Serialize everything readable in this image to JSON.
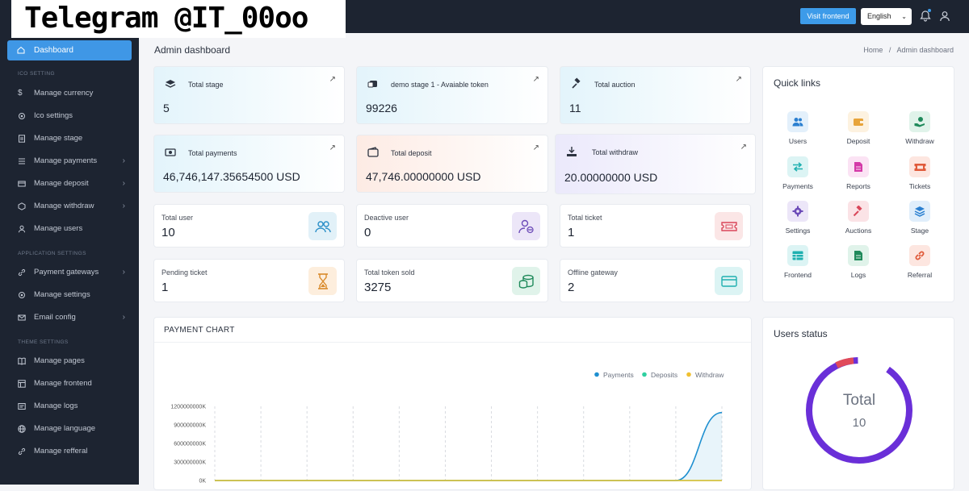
{
  "watermark": "Telegram @IT_00oo",
  "header": {
    "visit_frontend": "Visit frontend",
    "language": "English",
    "icons": [
      "bell-icon",
      "user-icon"
    ]
  },
  "sidebar": {
    "dashboard": "Dashboard",
    "section_ico": "ICO SETTING",
    "manage_currency": "Manage currency",
    "ico_settings": "Ico settings",
    "manage_stage": "Manage stage",
    "manage_payments": "Manage payments",
    "manage_deposit": "Manage deposit",
    "manage_withdraw": "Manage withdraw",
    "manage_users": "Manage users",
    "section_app": "APPLICATION SETTINGS",
    "payment_gateways": "Payment gateways",
    "manage_settings": "Manage settings",
    "email_config": "Email config",
    "section_theme": "THEME SETTINGS",
    "manage_pages": "Manage pages",
    "manage_frontend": "Manage frontend",
    "manage_logs": "Manage logs",
    "manage_language": "Manage language",
    "manage_refferal": "Manage refferal"
  },
  "page": {
    "title": "Admin dashboard",
    "breadcrumb_home": "Home",
    "breadcrumb_sep": "/",
    "breadcrumb_current": "Admin dashboard"
  },
  "stats": {
    "total_stage_label": "Total stage",
    "total_stage_value": "5",
    "demo_stage_label": "demo stage 1 - Avaiable token",
    "demo_stage_value": "99226",
    "total_auction_label": "Total auction",
    "total_auction_value": "11",
    "total_payments_label": "Total payments",
    "total_payments_value": "46,746,147.35654500 USD",
    "total_deposit_label": "Total deposit",
    "total_deposit_value": "47,746.00000000 USD",
    "total_withdraw_label": "Total withdraw",
    "total_withdraw_value": "20.00000000 USD",
    "arrow": "↗"
  },
  "mini": {
    "total_user_label": "Total user",
    "total_user_value": "10",
    "deactive_user_label": "Deactive user",
    "deactive_user_value": "0",
    "total_ticket_label": "Total ticket",
    "total_ticket_value": "1",
    "pending_ticket_label": "Pending ticket",
    "pending_ticket_value": "1",
    "token_sold_label": "Total token sold",
    "token_sold_value": "3275",
    "offline_gateway_label": "Offline gateway",
    "offline_gateway_value": "2"
  },
  "quick_links": {
    "title": "Quick links",
    "items": [
      "Users",
      "Deposit",
      "Withdraw",
      "Payments",
      "Reports",
      "Tickets",
      "Settings",
      "Auctions",
      "Stage",
      "Frontend",
      "Logs",
      "Referral"
    ]
  },
  "payment_chart": {
    "title": "PAYMENT CHART",
    "legend": [
      "Payments",
      "Deposits",
      "Withdraw"
    ],
    "colors": {
      "payments": "#1e8fd0",
      "deposits": "#2fd0a0",
      "withdraw": "#f0c030"
    },
    "y_ticks": [
      "1200000000K",
      "900000000K",
      "600000000K",
      "300000000K",
      "0K"
    ]
  },
  "users_status": {
    "title": "Users status",
    "total_label": "Total",
    "total_value": "10",
    "colors": {
      "main": "#6a2fd8",
      "accent": "#e04a5a"
    }
  },
  "chart_data": {
    "type": "area",
    "title": "PAYMENT CHART",
    "legend_position": "top-right",
    "series": [
      {
        "name": "Payments",
        "values": [
          0,
          0,
          0,
          0,
          0,
          0,
          0,
          0,
          0,
          0,
          0,
          1100000000
        ]
      },
      {
        "name": "Deposits",
        "values": [
          0,
          0,
          0,
          0,
          0,
          0,
          0,
          0,
          0,
          0,
          0,
          0
        ]
      },
      {
        "name": "Withdraw",
        "values": [
          0,
          0,
          0,
          0,
          0,
          0,
          0,
          0,
          0,
          0,
          0,
          0
        ]
      }
    ],
    "ylim": [
      0,
      1200000000
    ],
    "y_ticks": [
      "1200000000K",
      "900000000K",
      "600000000K",
      "300000000K",
      "0K"
    ],
    "grid": true
  }
}
